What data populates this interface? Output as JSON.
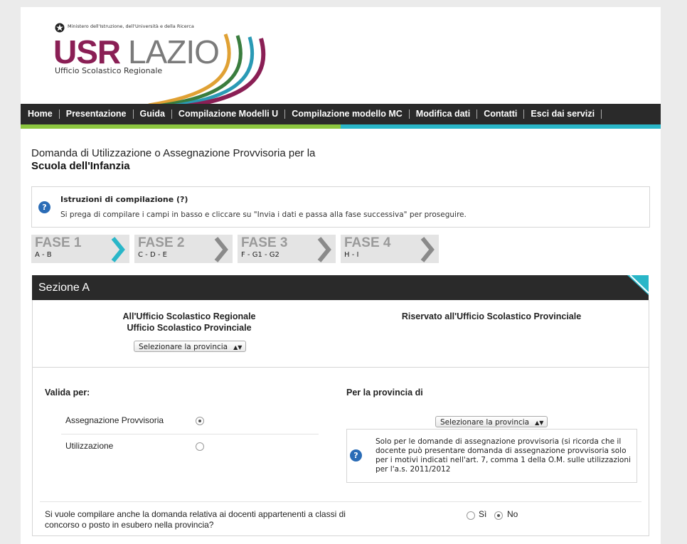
{
  "header": {
    "ministry": "Ministero dell'Istruzione, dell'Università e della Ricerca",
    "logo_usr": "USR",
    "logo_lazio": "LAZIO",
    "logo_sub": "Ufficio Scolastico Regionale",
    "swoosh_colors": [
      "#8a1f55",
      "#2a9ab5",
      "#3a7d3e",
      "#e0a134"
    ]
  },
  "nav": {
    "items": [
      "Home",
      "Presentazione",
      "Guida",
      "Compilazione Modelli U",
      "Compilazione modello MC",
      "Modifica dati",
      "Contatti",
      "Esci dai servizi"
    ]
  },
  "page": {
    "title_line1": "Domanda di Utilizzazione o Assegnazione Provvisoria per la",
    "title_line2": "Scuola dell'Infanzia"
  },
  "instructions": {
    "icon": "help-icon",
    "title": "Istruzioni di compilazione (?)",
    "text": "Si prega di compilare i campi in basso e cliccare su \"Invia i dati e passa alla fase successiva\" per proseguire."
  },
  "phases": [
    {
      "title": "FASE 1",
      "sub": "A - B",
      "active": true
    },
    {
      "title": "FASE 2",
      "sub": "C - D - E",
      "active": false
    },
    {
      "title": "FASE 3",
      "sub": "F - G1 - G2",
      "active": false
    },
    {
      "title": "FASE 4",
      "sub": "H - I",
      "active": false
    }
  ],
  "section": {
    "title": "Sezione A",
    "left_heading_1": "All'Ufficio Scolastico Regionale",
    "left_heading_2": "Ufficio Scolastico Provinciale",
    "right_heading": "Riservato all'Ufficio Scolastico Provinciale",
    "province_select": "Selezionare la provincia",
    "valida_per": "Valida per:",
    "option_assegnazione": "Assegnazione Provvisoria",
    "option_utilizzazione": "Utilizzazione",
    "selected_option": "Assegnazione Provvisoria",
    "per_provincia": "Per la provincia di",
    "province_select_2": "Selezionare la provincia",
    "note": "Solo per le domande di assegnazione provvisoria (si ricorda che il docente può presentare domanda di assegnazione provvisoria solo per i motivi indicati nell'art. 7, comma 1 della O.M. sulle utilizzazioni per l'a.s. 2011/2012",
    "question": "Si vuole compilare anche la domanda relativa ai docenti appartenenti a classi di concorso o posto in esubero nella provincia?",
    "yes_label": "Sì",
    "no_label": "No",
    "selected_answer": "No"
  },
  "colors": {
    "accent_teal": "#29b6c8",
    "accent_green": "#8cc63f",
    "logo_purple": "#8a1f55",
    "nav_bg": "#2a2a2a",
    "help_blue": "#2a6cb6"
  }
}
